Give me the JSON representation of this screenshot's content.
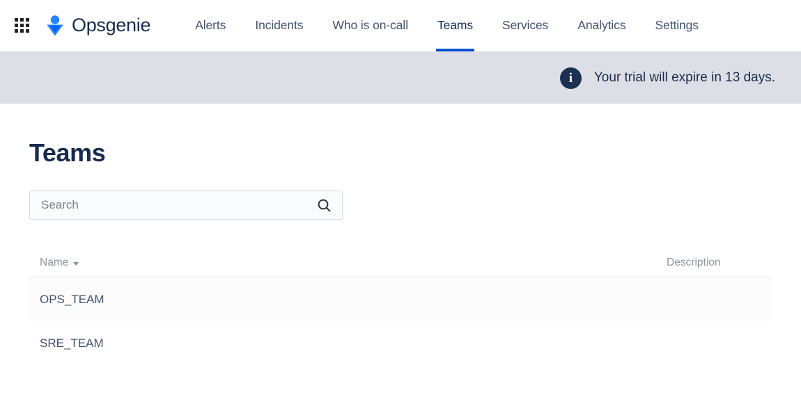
{
  "topnav": {
    "app_switcher_icon": "grid-apps-icon",
    "brand": {
      "logo_icon": "opsgenie-person-icon",
      "name": "Opsgenie"
    },
    "items": [
      {
        "label": "Alerts",
        "active": false
      },
      {
        "label": "Incidents",
        "active": false
      },
      {
        "label": "Who is on-call",
        "active": false
      },
      {
        "label": "Teams",
        "active": true
      },
      {
        "label": "Services",
        "active": false
      },
      {
        "label": "Analytics",
        "active": false
      },
      {
        "label": "Settings",
        "active": false
      }
    ],
    "active_indicator_color": "#0052cc"
  },
  "banner": {
    "icon": "info-circle-icon",
    "icon_glyph": "i",
    "message": "Your trial will expire in 13 days.",
    "background_color": "#dedfe6",
    "icon_color": "#1c3052"
  },
  "page": {
    "title": "Teams"
  },
  "search": {
    "value": "",
    "placeholder": "Search",
    "icon": "search-icon"
  },
  "table": {
    "columns": [
      {
        "key": "name",
        "label": "Name",
        "sorted": true,
        "sort_direction": "desc"
      },
      {
        "key": "description",
        "label": "Description",
        "sorted": false
      }
    ],
    "rows": [
      {
        "name": "OPS_TEAM",
        "description": ""
      },
      {
        "name": "SRE_TEAM",
        "description": ""
      }
    ]
  }
}
